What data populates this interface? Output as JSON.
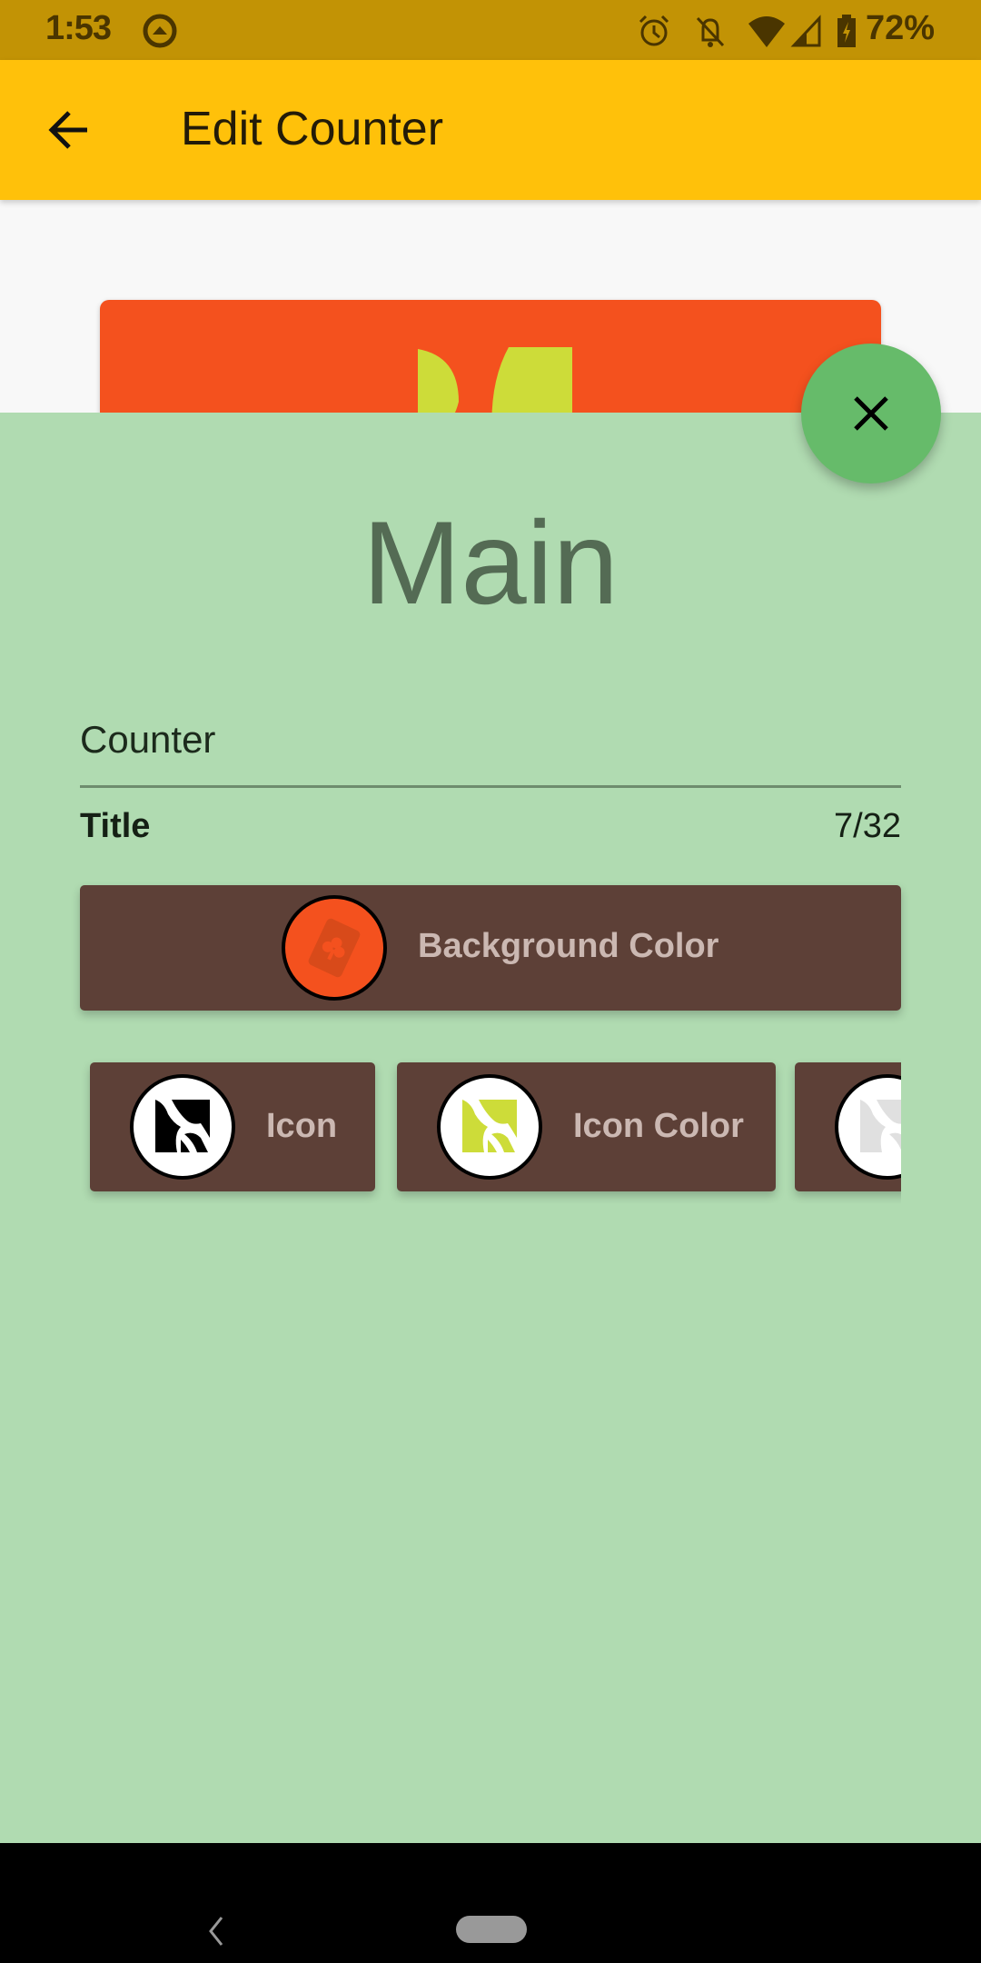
{
  "status_bar": {
    "time": "1:53",
    "battery_percent": "72%",
    "icons": [
      "auto-rotate-icon",
      "alarm-icon",
      "bell-off-icon",
      "wifi-icon",
      "cell-signal-icon",
      "battery-charging-icon"
    ]
  },
  "app_bar": {
    "title": "Edit Counter",
    "back_icon": "arrow-left-icon"
  },
  "preview": {
    "background_color": "#f4511e",
    "icon_color": "#cddc39"
  },
  "sheet": {
    "background_color": "#b0dbb1",
    "heading": "Main",
    "close_icon": "close-icon",
    "title_field": {
      "value": "Counter",
      "label": "Title",
      "char_count": "7/32"
    },
    "buttons": {
      "background_color": {
        "label": "Background Color",
        "swatch_color": "#f4511e",
        "swatch_icon": "playing-card-club-icon"
      },
      "icon": {
        "label": "Icon",
        "swatch_icon": "map-icon",
        "icon_color": "#000000"
      },
      "icon_color": {
        "label": "Icon Color",
        "swatch_icon": "map-icon",
        "icon_color": "#cddc39"
      },
      "partial_third": {
        "swatch_icon": "map-icon",
        "icon_color": "#e0e0e0"
      }
    }
  },
  "nav_bar": {
    "back_icon": "nav-back-icon",
    "home_icon": "nav-home-pill"
  }
}
